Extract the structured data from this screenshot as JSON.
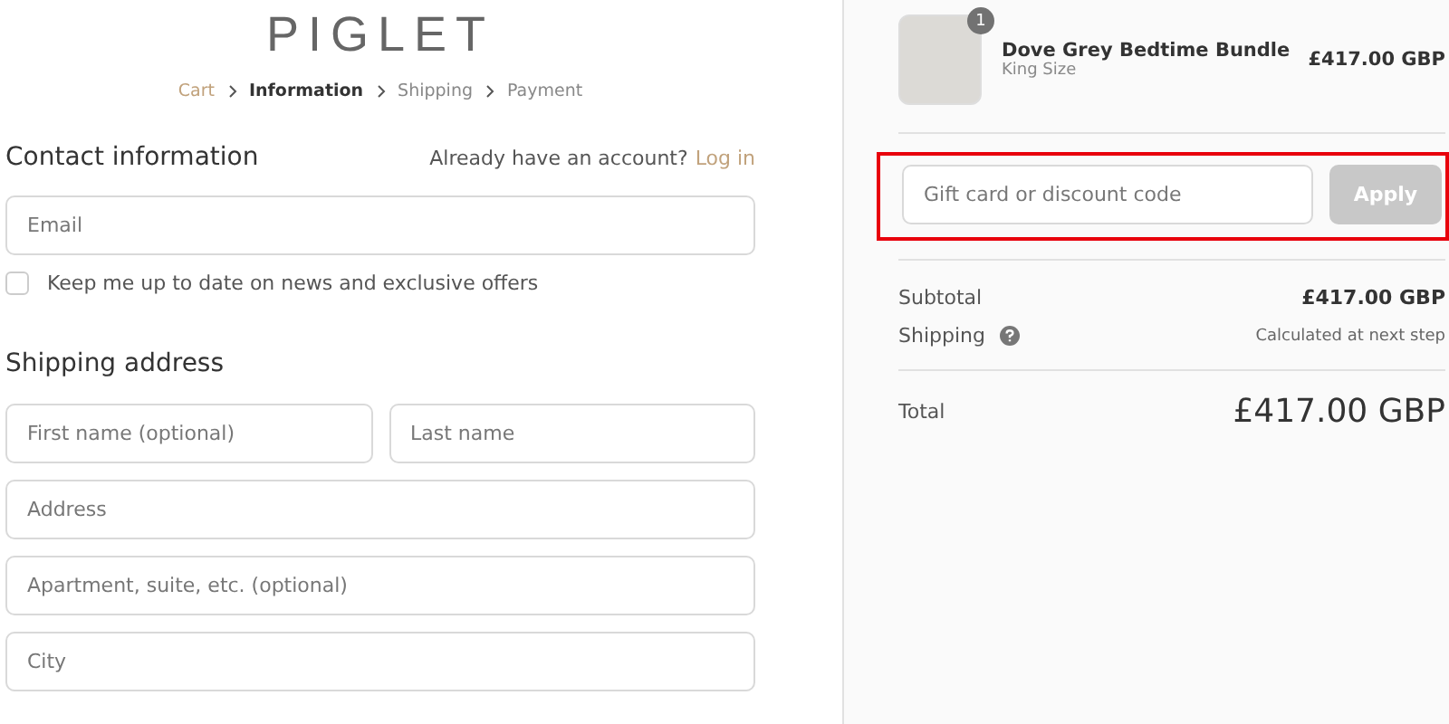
{
  "logo": "PIGLET",
  "breadcrumbs": [
    {
      "label": "Cart",
      "kind": "link"
    },
    {
      "label": "Information",
      "kind": "current"
    },
    {
      "label": "Shipping",
      "kind": "upcoming"
    },
    {
      "label": "Payment",
      "kind": "upcoming"
    }
  ],
  "contact": {
    "title": "Contact information",
    "account_prompt": "Already have an account?",
    "login_link": "Log in",
    "email_placeholder": "Email",
    "newsletter": {
      "label": "Keep me up to date on news and exclusive offers",
      "checked": false
    }
  },
  "shipping_address": {
    "title": "Shipping address",
    "rows": [
      [
        {
          "placeholder": "First name (optional)"
        },
        {
          "placeholder": "Last name"
        }
      ],
      [
        {
          "placeholder": "Address"
        }
      ],
      [
        {
          "placeholder": "Apartment, suite, etc. (optional)"
        }
      ],
      [
        {
          "placeholder": "City"
        }
      ]
    ]
  },
  "order": {
    "items": [
      {
        "name": "Dove Grey Bedtime Bundle",
        "variant": "King Size",
        "quantity": "1",
        "price": "£417.00 GBP"
      }
    ],
    "discount": {
      "placeholder": "Gift card or discount code",
      "button": "Apply",
      "disabled": true,
      "highlighted": true
    },
    "subtotal": {
      "label": "Subtotal",
      "value": "£417.00 GBP"
    },
    "shipping": {
      "label": "Shipping",
      "value": "Calculated at next step"
    },
    "total": {
      "label": "Total",
      "value": "£417.00 GBP"
    }
  }
}
